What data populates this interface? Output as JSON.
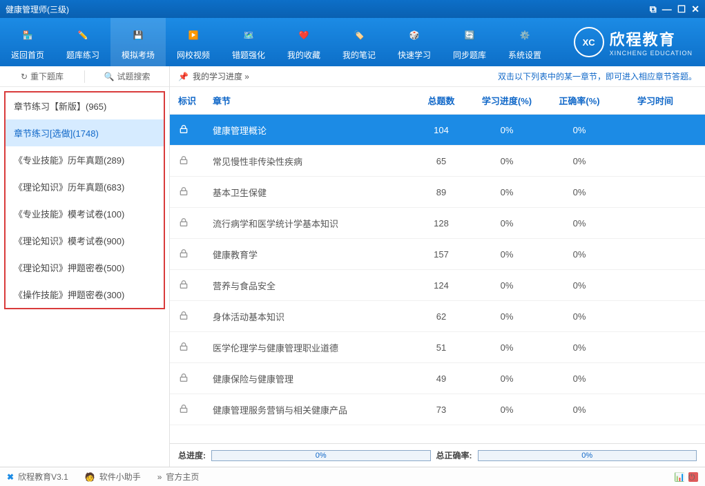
{
  "window_title": "健康管理师(三级)",
  "toolbar": [
    {
      "label": "返回首页",
      "icon": "home"
    },
    {
      "label": "题库练习",
      "icon": "pencil"
    },
    {
      "label": "模拟考场",
      "icon": "save",
      "active": true
    },
    {
      "label": "网校视频",
      "icon": "play"
    },
    {
      "label": "错题强化",
      "icon": "map"
    },
    {
      "label": "我的收藏",
      "icon": "heart"
    },
    {
      "label": "我的笔记",
      "icon": "tag"
    },
    {
      "label": "快速学习",
      "icon": "dice"
    },
    {
      "label": "同步题库",
      "icon": "sync"
    },
    {
      "label": "系统设置",
      "icon": "gear"
    }
  ],
  "brand": {
    "abbr": "XC",
    "cn": "欣程教育",
    "en": "XINCHENG EDUCATION"
  },
  "side_top": {
    "reload": "重下题库",
    "search": "试题搜索"
  },
  "categories": [
    "章节练习【新版】(965)",
    "章节练习[选做](1748)",
    "《专业技能》历年真题(289)",
    "《理论知识》历年真题(683)",
    "《专业技能》模考试卷(100)",
    "《理论知识》模考试卷(900)",
    "《理论知识》押题密卷(500)",
    "《操作技能》押题密卷(300)"
  ],
  "cat_selected": 1,
  "hint": {
    "left": "我的学习进度 »",
    "right": "双击以下列表中的某一章节，即可进入相应章节答题。"
  },
  "columns": {
    "mark": "标识",
    "chapter": "章节",
    "total": "总题数",
    "progress": "学习进度(%)",
    "accuracy": "正确率(%)",
    "time": "学习时间"
  },
  "rows": [
    {
      "name": "健康管理概论",
      "total": 104,
      "progress": "0%",
      "accuracy": "0%",
      "hl": true
    },
    {
      "name": "常见慢性非传染性疾病",
      "total": 65,
      "progress": "0%",
      "accuracy": "0%"
    },
    {
      "name": "基本卫生保健",
      "total": 89,
      "progress": "0%",
      "accuracy": "0%"
    },
    {
      "name": "流行病学和医学统计学基本知识",
      "total": 128,
      "progress": "0%",
      "accuracy": "0%"
    },
    {
      "name": "健康教育学",
      "total": 157,
      "progress": "0%",
      "accuracy": "0%"
    },
    {
      "name": "营养与食品安全",
      "total": 124,
      "progress": "0%",
      "accuracy": "0%"
    },
    {
      "name": "身体活动基本知识",
      "total": 62,
      "progress": "0%",
      "accuracy": "0%"
    },
    {
      "name": "医学伦理学与健康管理职业道德",
      "total": 51,
      "progress": "0%",
      "accuracy": "0%"
    },
    {
      "name": "健康保险与健康管理",
      "total": 49,
      "progress": "0%",
      "accuracy": "0%"
    },
    {
      "name": "健康管理服务营销与相关健康产品",
      "total": 73,
      "progress": "0%",
      "accuracy": "0%"
    }
  ],
  "footer": {
    "total_label": "总进度:",
    "total_val": "0%",
    "acc_label": "总正确率:",
    "acc_val": "0%"
  },
  "status": {
    "app": "欣程教育V3.1",
    "helper": "软件小助手",
    "home": "官方主页",
    "arrow": "»"
  },
  "winbtns": {
    "restore": "⧉",
    "min": "—",
    "max": "☐",
    "close": "✕"
  }
}
